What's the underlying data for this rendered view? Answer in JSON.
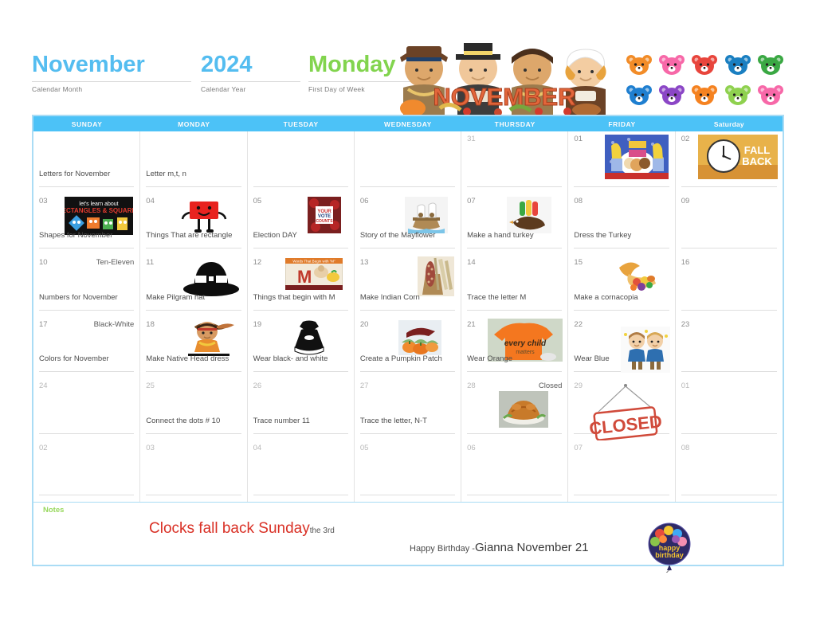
{
  "header": {
    "month": "November",
    "month_sub": "Calendar Month",
    "year": "2024",
    "year_sub": "Calendar Year",
    "first_day": "Monday",
    "first_day_sub": "First Day of Week",
    "banner_text": "NOVEMBER",
    "accent_blue": "#4cc2f7",
    "accent_green": "#82d44e",
    "banner_color": "#e2663b"
  },
  "weekdays": [
    "SUNDAY",
    "MONDAY",
    "TUESDAY",
    "WEDNESDAY",
    "THURSDAY",
    "FRIDAY",
    "Saturday"
  ],
  "weeks": [
    [
      {
        "num": "",
        "note": "",
        "event": "Letters for November",
        "pic": ""
      },
      {
        "num": "",
        "note": "",
        "event": "Letter m,t, n",
        "pic": ""
      },
      {
        "num": "",
        "note": "",
        "event": "",
        "pic": ""
      },
      {
        "num": "",
        "note": "",
        "event": "",
        "pic": ""
      },
      {
        "num": "31",
        "note": "",
        "event": "",
        "pic": "",
        "dim": true
      },
      {
        "num": "01",
        "note": "",
        "event": "",
        "pic": "bananas-pyjamas"
      },
      {
        "num": "02",
        "note": "",
        "event": "",
        "pic": "fall-back-clock"
      }
    ],
    [
      {
        "num": "03",
        "note": "",
        "event": "Shapes for November",
        "pic": "shapes-poster"
      },
      {
        "num": "04",
        "note": "",
        "event": "Things That are rectangle",
        "pic": "red-rectangle"
      },
      {
        "num": "05",
        "note": "",
        "event": "Election DAY",
        "pic": "election-vote"
      },
      {
        "num": "06",
        "note": "",
        "event": "Story of the Mayflower",
        "pic": "mayflower-ship"
      },
      {
        "num": "07",
        "note": "",
        "event": "Make a hand turkey",
        "pic": "hand-turkey"
      },
      {
        "num": "08",
        "note": "",
        "event": "Dress the Turkey",
        "pic": ""
      },
      {
        "num": "09",
        "note": "",
        "event": "",
        "pic": ""
      }
    ],
    [
      {
        "num": "10",
        "note": "Ten-Eleven",
        "event": "Numbers for November",
        "pic": ""
      },
      {
        "num": "11",
        "note": "",
        "event": "Make Pilgram hat",
        "pic": "pilgrim-hat"
      },
      {
        "num": "12",
        "note": "",
        "event": "Things that begin with M",
        "pic": "letter-m-poster"
      },
      {
        "num": "13",
        "note": "",
        "event": "Make Indian Corn",
        "pic": "indian-corn"
      },
      {
        "num": "14",
        "note": "",
        "event": "Trace the letter M",
        "pic": ""
      },
      {
        "num": "15",
        "note": "",
        "event": "Make a cornacopia",
        "pic": "cornucopia"
      },
      {
        "num": "16",
        "note": "",
        "event": "",
        "pic": ""
      }
    ],
    [
      {
        "num": "17",
        "note": "Black-White",
        "event": "Colors for November",
        "pic": ""
      },
      {
        "num": "18",
        "note": "",
        "event": "Make Native Head dress",
        "pic": "native-girl"
      },
      {
        "num": "19",
        "note": "",
        "event": "Wear black- and white",
        "pic": "black-dress"
      },
      {
        "num": "20",
        "note": "",
        "event": "Create a Pumpkin Patch",
        "pic": "pumpkin-patch"
      },
      {
        "num": "21",
        "note": "",
        "event": "Wear Orange",
        "pic": "orange-shirt"
      },
      {
        "num": "22",
        "note": "",
        "event": "Wear Blue",
        "pic": "two-kids-blue"
      },
      {
        "num": "23",
        "note": "",
        "event": "",
        "pic": ""
      }
    ],
    [
      {
        "num": "24",
        "note": "",
        "event": "",
        "pic": "",
        "dim": true
      },
      {
        "num": "25",
        "note": "",
        "event": "Connect the dots # 10",
        "pic": "",
        "dim": true
      },
      {
        "num": "26",
        "note": "",
        "event": "Trace number 11",
        "pic": "",
        "dim": true
      },
      {
        "num": "27",
        "note": "",
        "event": "Trace the letter, N-T",
        "pic": "",
        "dim": true
      },
      {
        "num": "28",
        "note": "Closed",
        "event": "",
        "pic": "roast-turkey",
        "dim": true
      },
      {
        "num": "29",
        "note": "",
        "event": "",
        "pic": "closed-sign",
        "dim": true
      },
      {
        "num": "01",
        "note": "",
        "event": "",
        "pic": "",
        "dim": true
      }
    ],
    [
      {
        "num": "02",
        "note": "",
        "event": "",
        "pic": "",
        "dim": true
      },
      {
        "num": "03",
        "note": "",
        "event": "",
        "pic": "",
        "dim": true
      },
      {
        "num": "04",
        "note": "",
        "event": "",
        "pic": "",
        "dim": true
      },
      {
        "num": "05",
        "note": "",
        "event": "",
        "pic": "",
        "dim": true
      },
      {
        "num": "06",
        "note": "",
        "event": "",
        "pic": "",
        "dim": true
      },
      {
        "num": "07",
        "note": "",
        "event": "",
        "pic": "",
        "dim": true
      },
      {
        "num": "08",
        "note": "",
        "event": "",
        "pic": "",
        "dim": true
      }
    ]
  ],
  "notes": {
    "label": "Notes",
    "clocks_main": "Clocks fall back Sunday",
    "clocks_small": "the 3rd",
    "birthday_prefix": "Happy Birthday -",
    "birthday_main": "Gianna November 21",
    "balloon_text": "happy birthday"
  },
  "bear_colors": [
    "#f28c28",
    "#f768a8",
    "#e8453c",
    "#1a7fc1",
    "#3aa843",
    "#1f7fd0",
    "#8b46c6",
    "#f58220",
    "#8fd14f",
    "#f768a8"
  ]
}
